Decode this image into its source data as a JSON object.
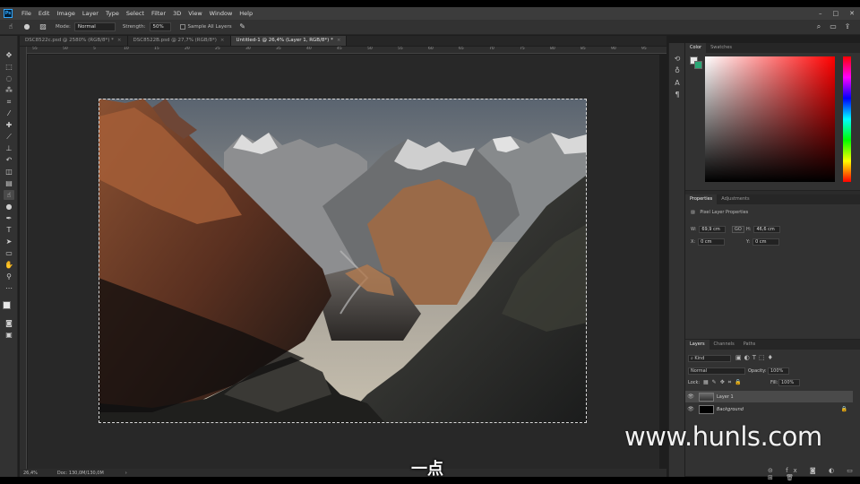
{
  "menu": [
    "File",
    "Edit",
    "Image",
    "Layer",
    "Type",
    "Select",
    "Filter",
    "3D",
    "View",
    "Window",
    "Help"
  ],
  "logo": "Ps",
  "window_controls": [
    "–",
    "□",
    "✕"
  ],
  "options": {
    "mode_label": "Mode:",
    "mode_value": "Normal",
    "strength_label": "Strength:",
    "strength_value": "50%",
    "sample_all_layers": "Sample All Layers"
  },
  "tabs": [
    {
      "label": "DSC8522c.psd @ 2580% (RGB/8*) *",
      "active": false
    },
    {
      "label": "DSC8522B.psd @ 27,7% (RGB/8*)",
      "active": false
    },
    {
      "label": "Untitled-1 @ 26,4% (Layer 1, RGB/8*) *",
      "active": true
    }
  ],
  "ruler_ticks": [
    "55",
    "50",
    "5",
    "10",
    "15",
    "20",
    "25",
    "30",
    "35",
    "40",
    "45",
    "50",
    "55",
    "60",
    "65",
    "70",
    "75",
    "80",
    "85",
    "90",
    "95"
  ],
  "status": {
    "zoom": "26,4%",
    "doc": "Doc: 130,0M/130,0M"
  },
  "color_panel": {
    "tabs": [
      "Color",
      "Swatches"
    ],
    "fg_color": "#e8e8e8",
    "bg_color": "#2aa876"
  },
  "properties_panel": {
    "tabs": [
      "Properties",
      "Adjustments"
    ],
    "title": "Pixel Layer Properties",
    "w_label": "W:",
    "w_value": "69,9 cm",
    "h_label": "H:",
    "h_value": "46,6 cm",
    "x_label": "X:",
    "x_value": "0 cm",
    "y_label": "Y:",
    "y_value": "0 cm",
    "link_label": "GO"
  },
  "layers_panel": {
    "tabs": [
      "Layers",
      "Channels",
      "Paths"
    ],
    "kind_label": "Kind",
    "blend_mode": "Normal",
    "opacity_label": "Opacity:",
    "opacity_value": "100%",
    "lock_label": "Lock:",
    "fill_label": "Fill:",
    "fill_value": "100%",
    "layers": [
      {
        "name": "Layer 1",
        "selected": true
      },
      {
        "name": "Background",
        "selected": false
      }
    ]
  },
  "watermark": "www.hunls.com",
  "subtitle": "一点"
}
